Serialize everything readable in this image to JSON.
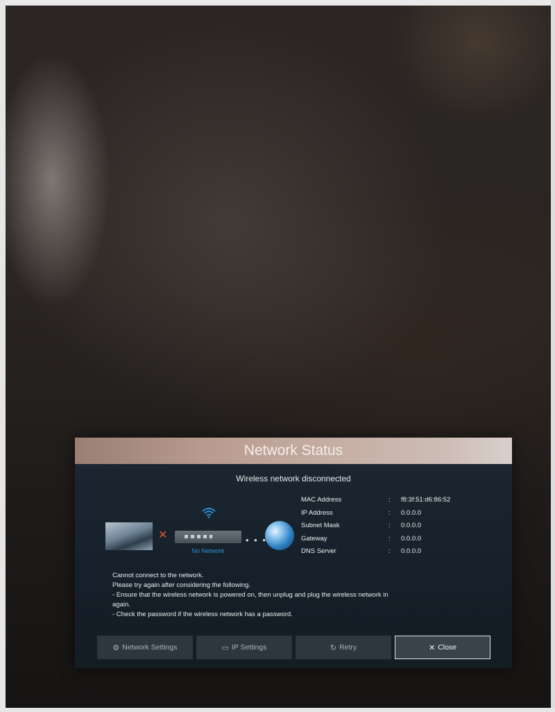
{
  "dialog": {
    "title": "Network Status",
    "subtitle": "Wireless network disconnected",
    "router_label": "No Network",
    "info": [
      {
        "label": "MAC Address",
        "value": "f8:3f:51:d6:86:52"
      },
      {
        "label": "IP Address",
        "value": "0.0.0.0"
      },
      {
        "label": "Subnet Mask",
        "value": "0.0.0.0"
      },
      {
        "label": "Gateway",
        "value": "0.0.0.0"
      },
      {
        "label": "DNS Server",
        "value": "0.0.0.0"
      }
    ],
    "separator": ":",
    "message": [
      "Cannot connect to the network.",
      "Please try again after considering the following.",
      " - Ensure that the wireless network is powered on, then unplug and plug the wireless network in",
      "again.",
      " - Check the password if the wireless network has a password."
    ],
    "buttons": {
      "network_settings": "Network Settings",
      "ip_settings": "IP Settings",
      "retry": "Retry",
      "close": "Close"
    }
  },
  "icons": {
    "network_settings": "gear-icon",
    "ip_settings": "ip-icon",
    "retry": "refresh-icon",
    "close": "close-icon",
    "connection_broken": "x-mark-icon",
    "wifi": "wifi-icon",
    "internet": "globe-icon"
  },
  "colors": {
    "title_bar_start": "#9a7f74",
    "title_bar_end": "#d9d0cc",
    "dialog_bg": "#1d2731",
    "accent_blue": "#2e8fd8",
    "error_red": "#e0553a"
  }
}
